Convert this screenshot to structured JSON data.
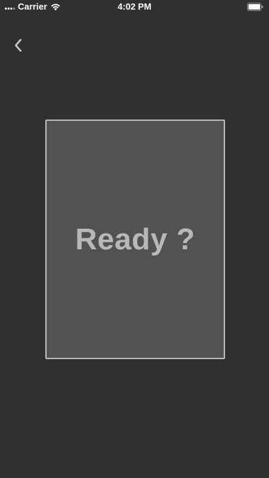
{
  "status_bar": {
    "carrier": "Carrier",
    "time": "4:02 PM",
    "icons": [
      "signal-icon",
      "wifi-icon",
      "battery-icon"
    ]
  },
  "nav": {
    "back_icon": "chevron-left-icon"
  },
  "card": {
    "label": "Ready ?"
  },
  "colors": {
    "background": "#2f3031",
    "card_fill": "#525252",
    "card_border": "#b9b9b9",
    "card_text": "#b8b8b8"
  }
}
